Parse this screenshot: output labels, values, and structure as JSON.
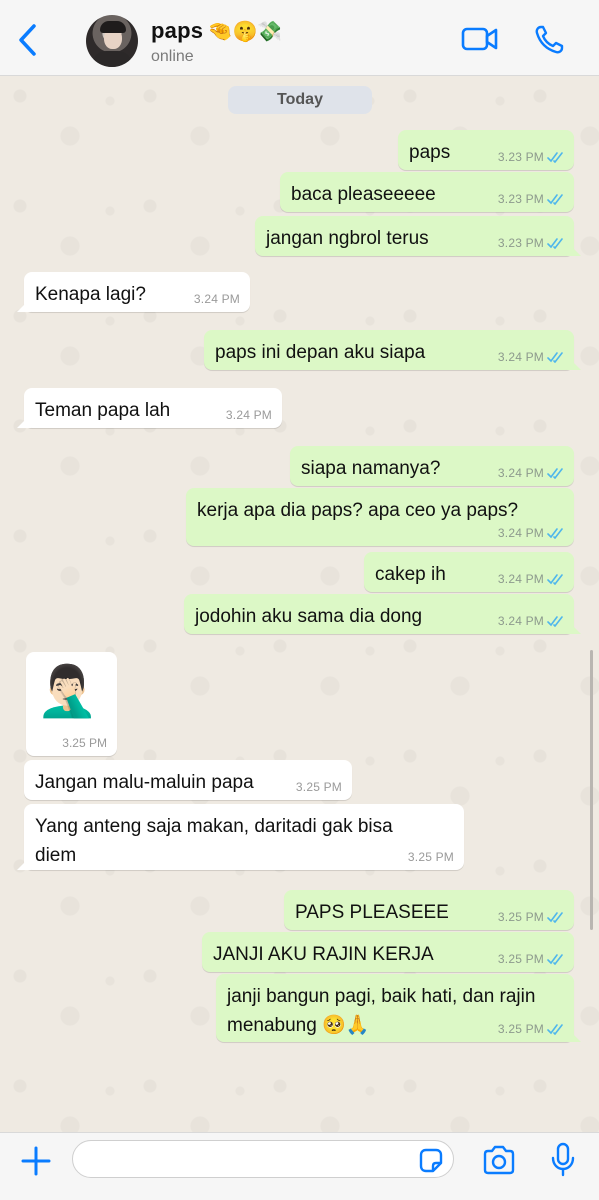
{
  "header": {
    "contact_name": "paps",
    "name_emoji": "🤏🤫💸",
    "status": "online",
    "back_icon": "chevron-left-icon",
    "video_icon": "video-camera-icon",
    "call_icon": "phone-icon",
    "accent": "#0a7cff"
  },
  "chat": {
    "date_label": "Today",
    "messages": [
      {
        "dir": "out",
        "text": "paps",
        "time": "3.23 PM"
      },
      {
        "dir": "out",
        "text": "baca pleaseeeee",
        "time": "3.23 PM"
      },
      {
        "dir": "out",
        "text": "jangan ngbrol terus",
        "time": "3.23 PM"
      },
      {
        "dir": "in",
        "text": "Kenapa lagi?",
        "time": "3.24 PM"
      },
      {
        "dir": "out",
        "text": "paps ini depan aku siapa",
        "time": "3.24 PM"
      },
      {
        "dir": "in",
        "text": "Teman papa lah",
        "time": "3.24 PM"
      },
      {
        "dir": "out",
        "text": "siapa namanya?",
        "time": "3.24 PM"
      },
      {
        "dir": "out",
        "text": "kerja apa dia paps? apa ceo ya paps?",
        "time": "3.24 PM"
      },
      {
        "dir": "out",
        "text": "cakep ih",
        "time": "3.24 PM"
      },
      {
        "dir": "out",
        "text": "jodohin aku sama dia dong",
        "time": "3.24 PM"
      },
      {
        "dir": "in",
        "type": "sticker",
        "text": "🤦🏻‍♂️",
        "time": "3.25 PM"
      },
      {
        "dir": "in",
        "text": "Jangan malu-maluin papa",
        "time": "3.25 PM"
      },
      {
        "dir": "in",
        "text": "Yang anteng saja makan, daritadi gak bisa\ndiem",
        "time": "3.25 PM"
      },
      {
        "dir": "out",
        "text": "PAPS PLEASEEE",
        "time": "3.25 PM"
      },
      {
        "dir": "out",
        "text": "JANJI AKU RAJIN KERJA",
        "time": "3.25 PM"
      },
      {
        "dir": "out",
        "text": "janji bangun pagi, baik hati, dan rajin\nmenabung 🥺🙏",
        "time": "3.25 PM"
      }
    ],
    "out_bubble_color": "#dcf8c6",
    "in_bubble_color": "#ffffff",
    "read_tick_color": "#4fb6ec"
  },
  "footer": {
    "input_value": "",
    "add_icon": "plus-icon",
    "sticker_icon": "sticker-icon",
    "camera_icon": "camera-icon",
    "mic_icon": "microphone-icon"
  }
}
